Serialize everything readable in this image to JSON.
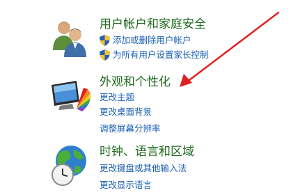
{
  "categories": [
    {
      "title": "用户帐户和家庭安全",
      "icon": "users-icon",
      "links": [
        {
          "label": "添加或删除用户帐户",
          "shield": true
        },
        {
          "label": "为所有用户设置家长控制",
          "shield": true
        }
      ]
    },
    {
      "title": "外观和个性化",
      "icon": "personalization-icon",
      "links": [
        {
          "label": "更改主题",
          "shield": false
        },
        {
          "label": "更改桌面背景",
          "shield": false
        },
        {
          "label": "调整屏幕分辨率",
          "shield": false
        }
      ]
    },
    {
      "title": "时钟、语言和区域",
      "icon": "clock-globe-icon",
      "links": [
        {
          "label": "更改键盘或其他输入法",
          "shield": false
        },
        {
          "label": "更改显示语言",
          "shield": false
        }
      ]
    }
  ],
  "colors": {
    "title": "#1e6b1e",
    "link": "#1a5fb4",
    "arrow": "#e02020"
  }
}
